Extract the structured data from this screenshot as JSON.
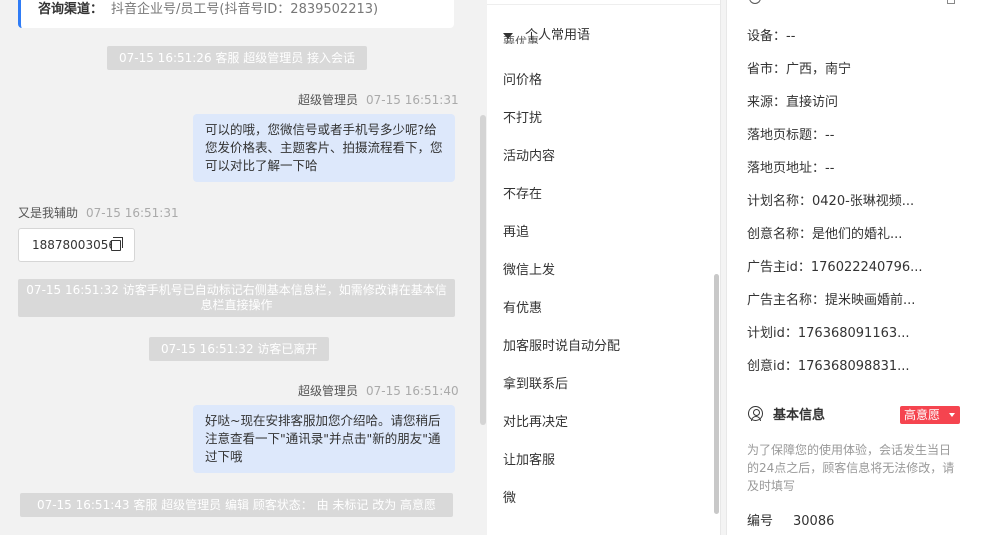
{
  "chat": {
    "channel_label": "咨询渠道：",
    "channel_value": "抖音企业号/员工号(抖音号ID：2839502213)",
    "messages": [
      {
        "type": "system",
        "text": "07-15 16:51:26 客服 超级管理员 接入会话"
      },
      {
        "type": "agent",
        "sender": "超级管理员",
        "time": "07-15 16:51:31",
        "text": "可以的哦，您微信号或者手机号多少呢?给您发价格表、主题客片、拍摄流程看下，您可以对比了解一下哈"
      },
      {
        "type": "visitor",
        "sender": "又是我辅助",
        "time": "07-15 16:51:31",
        "text": "18878003056"
      },
      {
        "type": "system",
        "text": "07-15 16:51:32 访客手机号已自动标记右侧基本信息栏，如需修改请在基本信息栏直接操作"
      },
      {
        "type": "system",
        "text": "07-15 16:51:32 访客已离开"
      },
      {
        "type": "agent",
        "sender": "超级管理员",
        "time": "07-15 16:51:40",
        "text": "好哒~现在安排客服加您介绍哈。请您稍后注意查看一下\"通讯录\"并点击\"新的朋友\"通过下哦"
      },
      {
        "type": "system",
        "text": "07-15 16:51:43 客服 超级管理员 编辑 顾客状态： 由 未标记 改为 高意愿"
      }
    ]
  },
  "phrases": {
    "header": "个人常用语",
    "ghost": "要优惠",
    "items": [
      "问价格",
      "不打扰",
      "活动内容",
      "不存在",
      "再追",
      "微信上发",
      "有优惠",
      "加客服时说自动分配",
      "拿到联系后",
      "对比再决定",
      "让加客服",
      "微"
    ]
  },
  "info": {
    "rows": [
      {
        "label": "设备：",
        "value": "--"
      },
      {
        "label": "省市：",
        "value": "广西，南宁"
      },
      {
        "label": "来源：",
        "value": "直接访问"
      },
      {
        "label": "落地页标题：",
        "value": "--"
      },
      {
        "label": "落地页地址：",
        "value": "--"
      },
      {
        "label": "计划名称：",
        "value": "0420-张琳视频..."
      },
      {
        "label": "创意名称：",
        "value": "是他们的婚礼..."
      },
      {
        "label": "广告主id：",
        "value": "176022240796..."
      },
      {
        "label": "广告主名称：",
        "value": "提米映画婚前..."
      },
      {
        "label": "计划id：",
        "value": "176368091163..."
      },
      {
        "label": "创意id：",
        "value": "176368098831..."
      }
    ],
    "basic_title": "基本信息",
    "intent_label": "高意愿",
    "notice": "为了保障您的使用体验，会话发生当日的24点之后，顾客信息将无法修改，请及时填写",
    "number_label": "编号",
    "number_value": "30086"
  }
}
